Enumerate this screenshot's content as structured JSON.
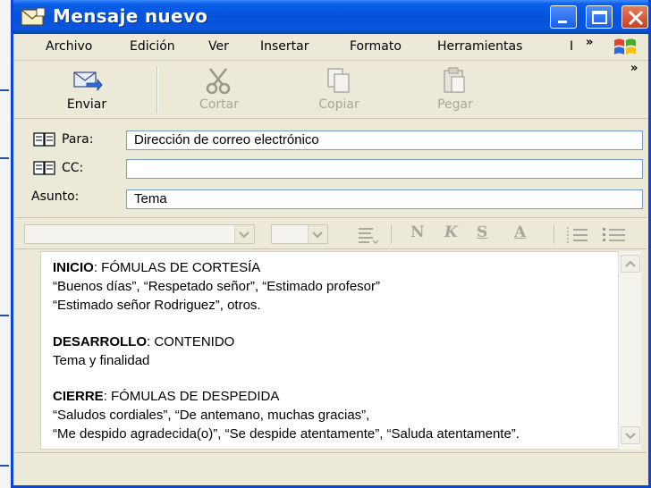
{
  "window": {
    "title": "Mensaje nuevo"
  },
  "menu": {
    "items": [
      "Archivo",
      "Edición",
      "Ver",
      "Insertar",
      "Formato",
      "Herramientas",
      "I"
    ],
    "more": "»",
    "toolbar_more": "»"
  },
  "toolbar": {
    "send": "Enviar",
    "cut": "Cortar",
    "copy": "Copiar",
    "paste": "Pegar"
  },
  "header": {
    "to_label": "Para:",
    "to_value": "Dirección de correo electrónico",
    "cc_label": "CC:",
    "cc_value": "",
    "subject_label": "Asunto:",
    "subject_value": "Tema"
  },
  "format": {
    "bold": "N",
    "italic": "K",
    "underline": "S",
    "color": "A"
  },
  "body": {
    "s1_heading": "INICIO",
    "s1_heading_rest": ": FÓMULAS DE CORTESÍA",
    "s1_line1": "“Buenos días”, “Respetado señor”, “Estimado profesor”",
    "s1_line2": "“Estimado señor Rodriguez”, otros.",
    "s2_heading": "DESARROLLO",
    "s2_heading_rest": ": CONTENIDO",
    "s2_line1": "Tema y finalidad",
    "s3_heading": "CIERRE",
    "s3_heading_rest": ": FÓMULAS DE DESPEDIDA",
    "s3_line1": "“Saludos cordiales”, “De antemano, muchas gracias”,",
    "s3_line2": "“Me despido agradecida(o)”, “Se despide atentamente”, “Saluda atentamente”."
  },
  "colors": {
    "title_blue": "#0553db",
    "chrome": "#ece9d8",
    "field_border": "#7f9db9"
  }
}
